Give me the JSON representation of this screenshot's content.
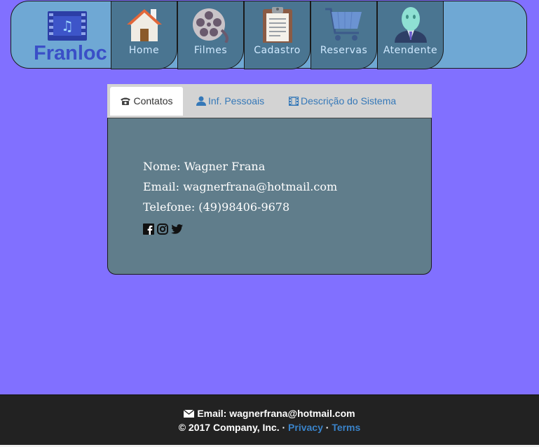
{
  "header": {
    "logo_text": "Franloc",
    "nav": [
      {
        "label": "Home",
        "icon": "home-icon"
      },
      {
        "label": "Filmes",
        "icon": "film-reel-icon"
      },
      {
        "label": "Cadastro",
        "icon": "clipboard-icon"
      },
      {
        "label": "Reservas",
        "icon": "shopping-cart-icon"
      },
      {
        "label": "Atendente",
        "icon": "attendant-icon"
      }
    ]
  },
  "tabs": [
    {
      "label": "Contatos",
      "icon": "phone-icon",
      "active": true
    },
    {
      "label": "Inf. Pessoais",
      "icon": "user-icon",
      "active": false
    },
    {
      "label": "Descrição do Sistema",
      "icon": "film-icon",
      "active": false
    }
  ],
  "contact": {
    "name": "Nome: Wagner Frana",
    "email": "Email: wagnerfrana@hotmail.com",
    "phone": "Telefone: (49)98406-9678",
    "social": [
      "facebook-icon",
      "instagram-icon",
      "twitter-icon"
    ]
  },
  "footer": {
    "email": "Email: wagnerfrana@hotmail.com",
    "copyright": "© 2017 Company, Inc. · ",
    "privacy": "Privacy",
    "separator": " · ",
    "terms": "Terms"
  },
  "colors": {
    "background": "#8170ff",
    "header": "#6fa8d4",
    "nav_item": "#4a7591",
    "panel": "#607d8b",
    "tabbar": "#d3d3d3",
    "link": "#3578b8",
    "footer": "#222222"
  }
}
